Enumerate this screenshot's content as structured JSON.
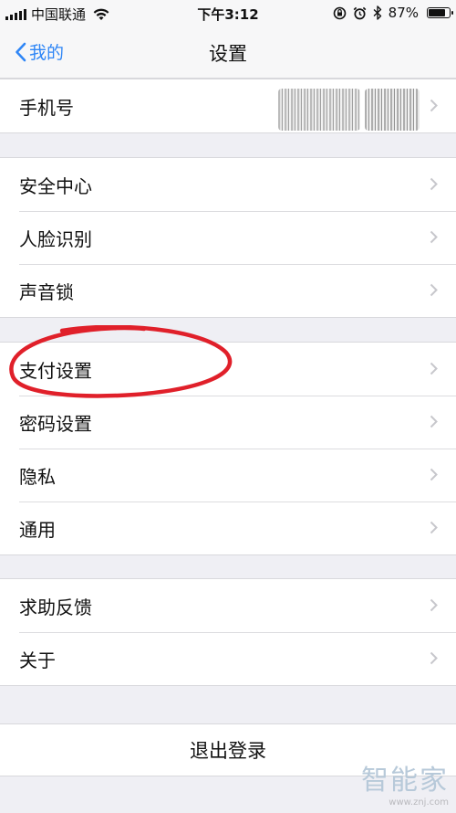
{
  "status": {
    "carrier": "中国联通",
    "time": "下午3:12",
    "battery": "87%",
    "battery_level": 0.87
  },
  "nav": {
    "back_label": "我的",
    "title": "设置"
  },
  "groups": [
    {
      "items": [
        {
          "label": "手机号"
        }
      ]
    },
    {
      "items": [
        {
          "label": "安全中心"
        },
        {
          "label": "人脸识别"
        },
        {
          "label": "声音锁"
        }
      ]
    },
    {
      "items": [
        {
          "label": "支付设置"
        },
        {
          "label": "密码设置"
        },
        {
          "label": "隐私"
        },
        {
          "label": "通用"
        }
      ]
    },
    {
      "items": [
        {
          "label": "求助反馈"
        },
        {
          "label": "关于"
        }
      ]
    }
  ],
  "logout_label": "退出登录",
  "watermark": {
    "text": "智能家",
    "url": "www.znj.com"
  },
  "colors": {
    "accent": "#2f86f6",
    "annotation": "#e0202a",
    "background": "#efeff4"
  }
}
